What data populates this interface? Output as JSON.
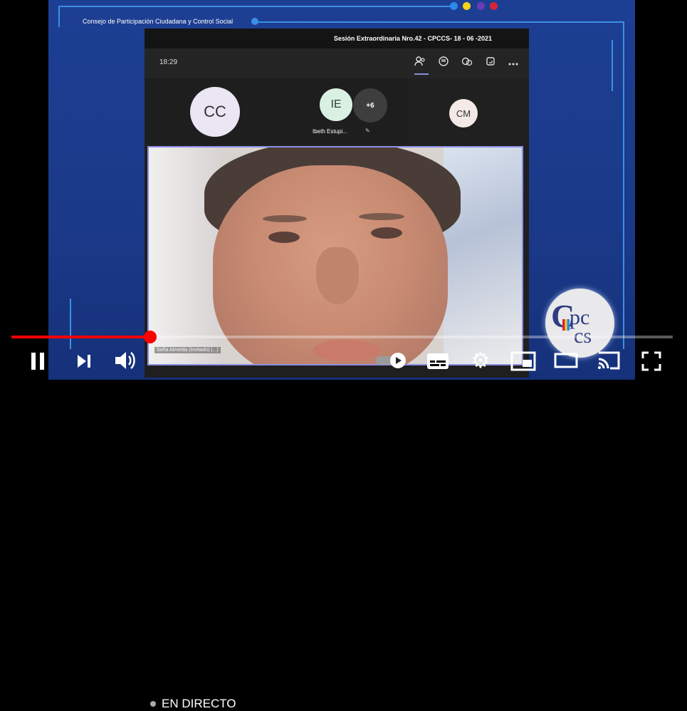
{
  "player": {
    "organization": "Consejo de Participación Ciudadana y Control Social",
    "live_label": "EN DIRECTO",
    "progress_fraction": 0.21,
    "accent_colors": [
      "#2b8be8",
      "#f6d31a",
      "#6c3bb7",
      "#d6263a"
    ]
  },
  "meeting": {
    "title": "Sesión Extraordinaria Nro.42 - CPCCS- 18 - 06 -2021",
    "time": "18:29",
    "toolbar_icons": [
      "participants-icon",
      "chat-icon",
      "reactions-icon",
      "share-icon",
      "more-icon"
    ],
    "tiles": [
      {
        "initials": "CC",
        "name": ""
      },
      {
        "initials": "IE",
        "name": "Ibeth Estupi..."
      },
      {
        "initials": "+6",
        "name": ""
      },
      {
        "initials": "CM",
        "name": ""
      }
    ],
    "main_video_caption": "Sofía Almeida (Invitado) (...)"
  },
  "logo": {
    "text": "CPCCS"
  },
  "controls": {
    "icons": [
      "pause-icon",
      "next-icon",
      "volume-icon",
      "autoplay-toggle",
      "subtitles-icon",
      "settings-icon",
      "miniplayer-icon",
      "theater-icon",
      "cast-icon",
      "fullscreen-icon"
    ]
  }
}
